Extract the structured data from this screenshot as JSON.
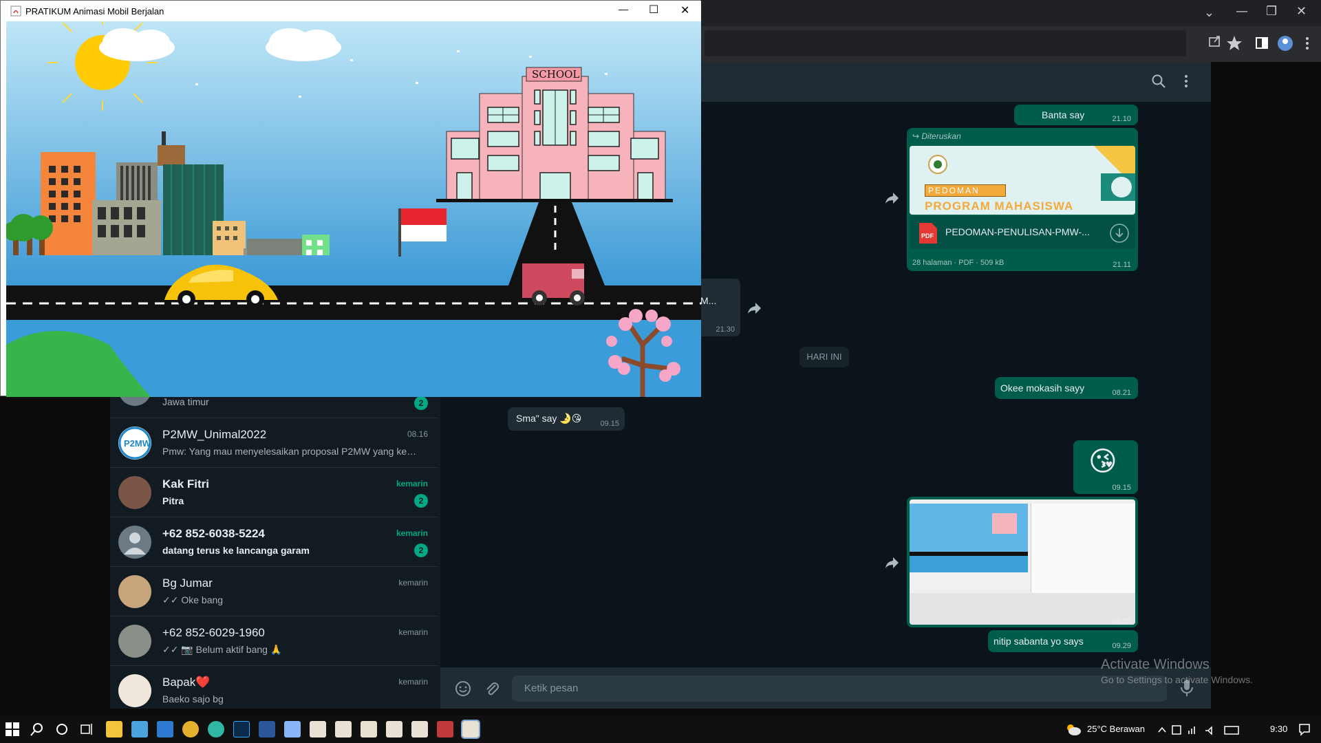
{
  "java_window": {
    "title": "PRATIKUM Animasi Mobil Berjalan",
    "minimize": "—",
    "maximize": "☐",
    "close": "✕",
    "school_sign": "SCHOOL"
  },
  "browser": {
    "controls": {
      "chevron": "⌄",
      "minimize": "—",
      "restore": "❐",
      "close": "✕"
    }
  },
  "chat_list": [
    {
      "name": "",
      "preview": "Jawa timur",
      "time": "",
      "badge": "2"
    },
    {
      "name": "P2MW_Unimal2022",
      "preview": "Pmw: Yang mau menyelesaikan proposal P2MW yang kem...",
      "time": "08.16",
      "badge": ""
    },
    {
      "name": "Kak Fitri",
      "preview": "Pitra",
      "time": "kemarin",
      "badge": "2"
    },
    {
      "name": "+62 852-6038-5224",
      "preview": "datang terus ke lancanga garam",
      "time": "kemarin",
      "badge": "2"
    },
    {
      "name": "Bg Jumar",
      "preview": "✓✓ Oke bang",
      "time": "kemarin",
      "badge": ""
    },
    {
      "name": "+62 852-6029-1960",
      "preview": "✓✓ 📷 Belum aktif bang 🙏",
      "time": "kemarin",
      "badge": ""
    },
    {
      "name": "Bapak❤️",
      "preview": "Baeko sajo bg",
      "time": "kemarin",
      "badge": ""
    }
  ],
  "messages": {
    "m1": {
      "text": "Banta say",
      "time": "21.10"
    },
    "forwarded_label": "Diteruskan",
    "doc": {
      "banner_line1": "PEDOMAN",
      "banner_line2": "PROGRAM MAHASISWA",
      "pdf_label": "PDF",
      "filename": "PEDOMAN-PENULISAN-PMW-...",
      "meta": "28 halaman · PDF · 509 kB",
      "time": "21.11"
    },
    "in1": {
      "text": "M...",
      "time": "21.30"
    },
    "day_divider": "HARI INI",
    "m2": {
      "text": "Okee mokasih sayy",
      "time": "08.21"
    },
    "in2": {
      "text": "Sma\" say 🌛😘",
      "time": "09.15"
    },
    "m3": {
      "emoji": "😘",
      "time": "09.15"
    },
    "m4": {
      "time": "09.28"
    },
    "m5": {
      "text": "nitip sabanta yo says",
      "time": "09.29"
    }
  },
  "composer": {
    "placeholder": "Ketik pesan"
  },
  "watermark": {
    "line1": "Activate Windows",
    "line2": "Go to Settings to activate Windows."
  },
  "taskbar": {
    "weather": "25°C  Berawan",
    "clock": "9:30"
  },
  "colors": {
    "accent": "#00a884",
    "outgoing": "#005c4b",
    "incoming": "#202c33"
  }
}
